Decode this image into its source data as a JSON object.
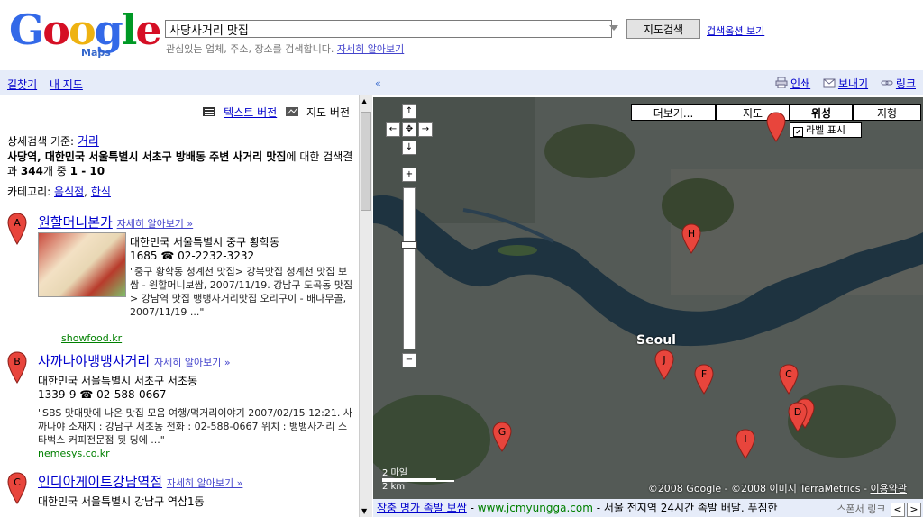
{
  "logo": {
    "text_parts": [
      "G",
      "o",
      "o",
      "g",
      "l",
      "e"
    ],
    "colors": [
      "#3369e8",
      "#d50f25",
      "#eeb211",
      "#3369e8",
      "#009925",
      "#d50f25"
    ],
    "sub": "Maps"
  },
  "search": {
    "value": "사당사거리 맛집",
    "button": "지도검색",
    "options_link": "검색옵션 보기",
    "hint": "관심있는 업체, 주소, 장소를 검색합니다.",
    "hint_link": "자세히 알아보기"
  },
  "nav": {
    "directions": "길찾기",
    "my_maps": "내 지도",
    "print": "인쇄",
    "send": "보내기",
    "link": "링크"
  },
  "panel": {
    "text_version": "텍스트 버전",
    "map_version": "지도 버전",
    "refine_label": "상세검색 기준:",
    "refine_link": "거리",
    "summary_prefix": "사당역, 대한민국 서울특별시 서초구 방배동 주변",
    "summary_bold": "사거리 맛집",
    "summary_mid": "에 대한 검색결과",
    "summary_total": "344",
    "summary_count_mid": "개 중",
    "summary_range": "1 - 10",
    "category_label": "카테고리:",
    "category_1": "음식점",
    "category_sep": ",",
    "category_2": "한식",
    "more_label": "자세히 알아보기 »"
  },
  "results": [
    {
      "letter": "A",
      "title": "원할머니본가",
      "address": "대한민국 서울특별시 중구 황학동",
      "phone_prefix": "1685",
      "phone": "02-2232-3232",
      "snippet": "\"중구 황학동 청계천 맛집> 강북맛집 청계천 맛집 보쌈 - 원할머니보쌈, 2007/11/19. 강남구 도곡동 맛집> 강남역 맛집 뱅뱅사거리맛집 오리구이 - 배나무골, 2007/11/19 ...\"",
      "url": "showfood.kr"
    },
    {
      "letter": "B",
      "title": "사까나야뱅뱅사거리",
      "address": "대한민국 서울특별시 서초구 서초동",
      "phone_prefix": "1339-9",
      "phone": "02-588-0667",
      "snippet": "\"SBS 맛대맛에 나온 맛집 모음 여행/먹거리이야기 2007/02/15 12:21. 사까나야 소재지 : 강남구 서초동 전화 : 02-588-0667 위치 : 뱅뱅사거리 스타벅스 커피전문점 뒷 딩에 ...\"",
      "url": "nemesys.co.kr"
    },
    {
      "letter": "C",
      "title": "인디아게이트강남역점",
      "address": "대한민국 서울특별시 강남구 역삼1동",
      "phone_prefix": "",
      "phone": "",
      "snippet": "",
      "url": ""
    }
  ],
  "map": {
    "buttons": [
      "더보기...",
      "지도",
      "위성",
      "지형"
    ],
    "selected": "위성",
    "labels_toggle": "라벨 표시",
    "city_label": "Seoul",
    "pins": [
      "A",
      "B",
      "C",
      "D",
      "F",
      "G",
      "H",
      "I",
      "J"
    ],
    "scale_top": "2 마일",
    "scale_bottom": "2 km",
    "copyright": "©2008 Google - ©2008 이미지 TerraMetrics -",
    "terms": "이용약관"
  },
  "ad": {
    "title": "장충 명가 족발 보쌈",
    "sep": "-",
    "url": "www.jcmyungga.com",
    "desc": "- 서울 전지역 24시간 족발 배달. 푸짐한",
    "sponsor": "스폰서 링크"
  }
}
